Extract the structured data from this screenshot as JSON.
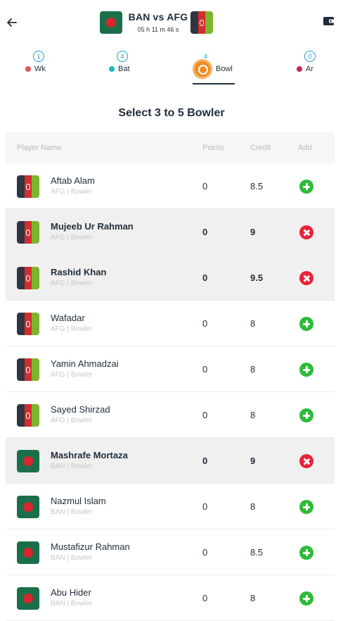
{
  "header": {
    "match_title": "BAN vs AFG",
    "timer": "05 h 11 m 46 s",
    "back_icon": "arrow-left-icon",
    "wallet_icon": "wallet-icon"
  },
  "tabs": [
    {
      "key": "wk",
      "count": "1",
      "label": "Wk",
      "dot_color": "#e2575f",
      "active": false
    },
    {
      "key": "bat",
      "count": "4",
      "label": "Bat",
      "dot_color": "#20b6c8",
      "active": false
    },
    {
      "key": "bowl",
      "count": "4",
      "label": "Bowl",
      "icon": "cricket-ball-icon",
      "active": true
    },
    {
      "key": "ar",
      "count": "0",
      "label": "Ar",
      "dot_color": "#c7274f",
      "active": false
    }
  ],
  "heading": "Select 3 to 5 Bowler",
  "table_header": {
    "player_name": "Player Name",
    "points": "Points",
    "credit": "Credit",
    "add": "Add"
  },
  "players": [
    {
      "name": "Aftab Alam",
      "meta": "AFG | Bowler",
      "team": "AFG",
      "points": "0",
      "credit": "8.5",
      "selected": false
    },
    {
      "name": "Mujeeb Ur Rahman",
      "meta": "AFG | Bowler",
      "team": "AFG",
      "points": "0",
      "credit": "9",
      "selected": true
    },
    {
      "name": "Rashid Khan",
      "meta": "AFG | Bowler",
      "team": "AFG",
      "points": "0",
      "credit": "9.5",
      "selected": true
    },
    {
      "name": "Wafadar",
      "meta": "AFG | Bowler",
      "team": "AFG",
      "points": "0",
      "credit": "8",
      "selected": false
    },
    {
      "name": "Yamin Ahmadzai",
      "meta": "AFG | Bowler",
      "team": "AFG",
      "points": "0",
      "credit": "8",
      "selected": false
    },
    {
      "name": "Sayed Shirzad",
      "meta": "AFG | Bowler",
      "team": "AFG",
      "points": "0",
      "credit": "8",
      "selected": false
    },
    {
      "name": "Mashrafe Mortaza",
      "meta": "BAN | Bowler",
      "team": "BAN",
      "points": "0",
      "credit": "9",
      "selected": true
    },
    {
      "name": "Nazmul Islam",
      "meta": "BAN | Bowler",
      "team": "BAN",
      "points": "0",
      "credit": "8",
      "selected": false
    },
    {
      "name": "Mustafizur Rahman",
      "meta": "BAN | Bowler",
      "team": "BAN",
      "points": "0",
      "credit": "8.5",
      "selected": false
    },
    {
      "name": "Abu Hider",
      "meta": "BAN | Bowler",
      "team": "BAN",
      "points": "0",
      "credit": "8",
      "selected": false
    }
  ],
  "colors": {
    "add": "#2fbb3a",
    "remove": "#e8233a",
    "accent": "#1a9bc9",
    "selected_row": "#f0f0f0"
  }
}
